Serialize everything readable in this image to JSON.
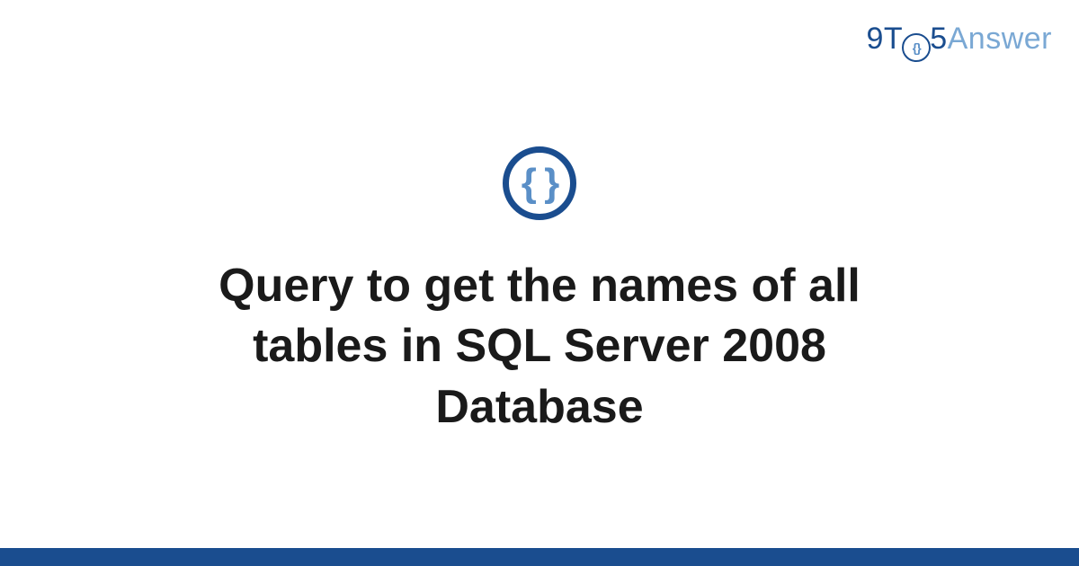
{
  "logo": {
    "part1": "9T",
    "circle_inner": "{}",
    "part2": "5",
    "part3": "Answer"
  },
  "icon": {
    "symbol": "{ }",
    "name": "code-braces-icon"
  },
  "title": "Query to get the names of all tables in SQL Server 2008 Database",
  "colors": {
    "brand_primary": "#1a4d8f",
    "brand_secondary": "#5a8fc7",
    "brand_light": "#7aa8d4",
    "text": "#1a1a1a"
  }
}
